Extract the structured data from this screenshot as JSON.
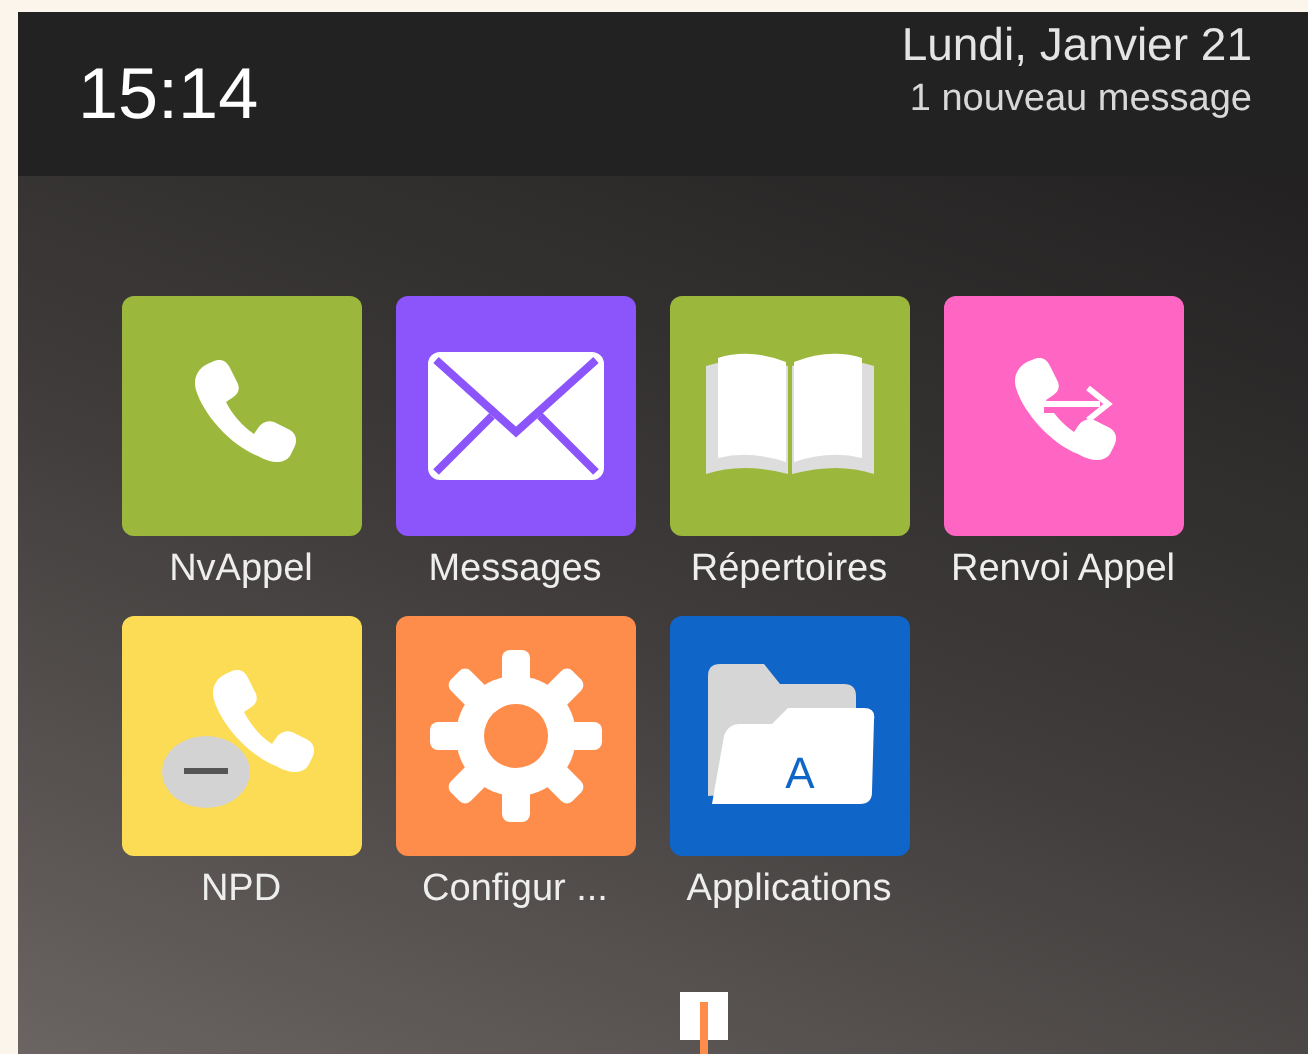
{
  "status_bar": {
    "time": "15:14",
    "date": "Lundi, Janvier 21",
    "notification": "1 nouveau message"
  },
  "apps": [
    {
      "label": "NvAppel",
      "kind": "phone",
      "color": "#9cb83c"
    },
    {
      "label": "Messages",
      "kind": "mail",
      "color": "#8c55fb"
    },
    {
      "label": "Répertoires",
      "kind": "book",
      "color": "#9cb83c"
    },
    {
      "label": "Renvoi Appel",
      "kind": "forward",
      "color": "#ff66c4"
    },
    {
      "label": "NPD",
      "kind": "dnd",
      "color": "#fddc55"
    },
    {
      "label": "Configur ...",
      "kind": "gear",
      "color": "#fe8c4a"
    },
    {
      "label": "Applications",
      "kind": "folder",
      "color": "#0f65c8",
      "icon_text": "A"
    }
  ]
}
